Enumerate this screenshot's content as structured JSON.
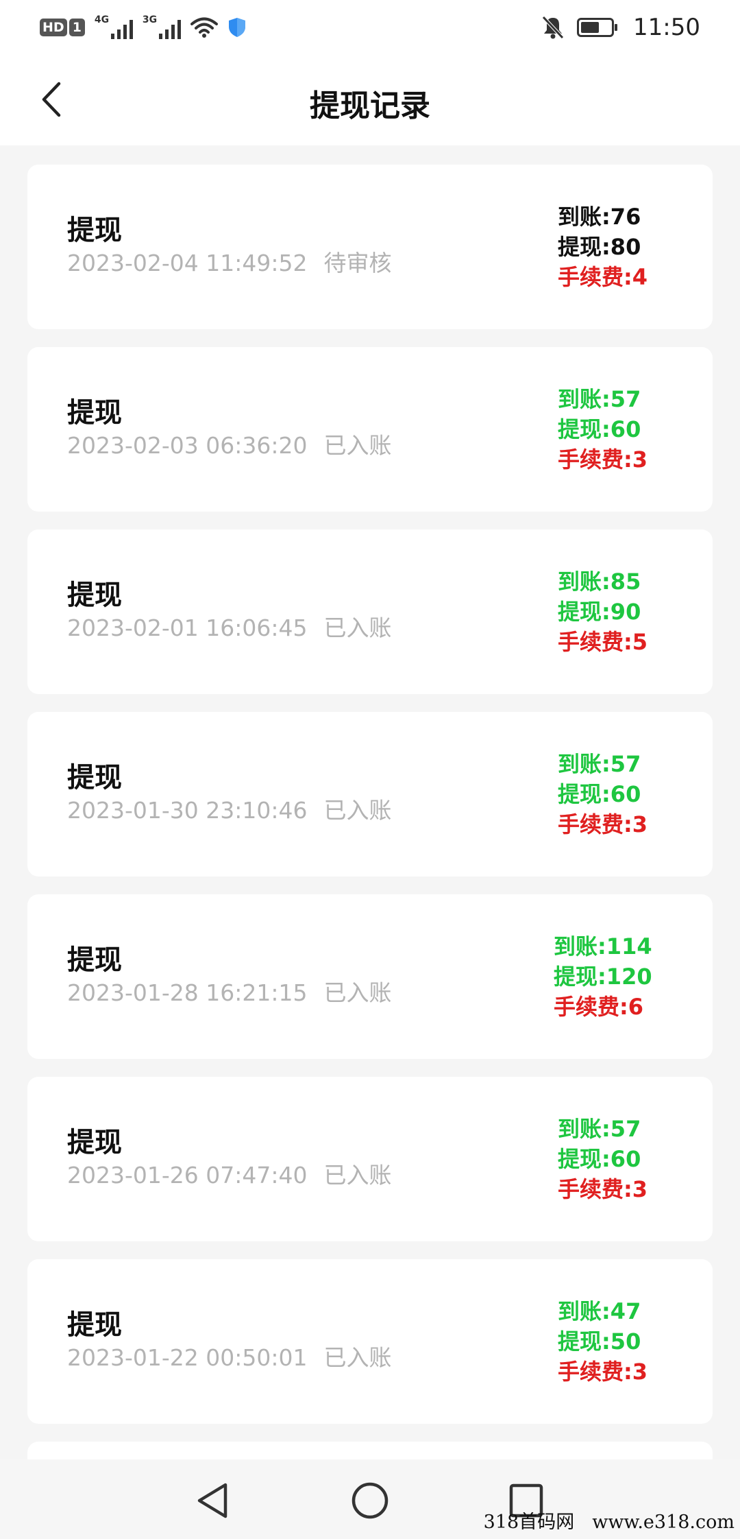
{
  "status_bar": {
    "hd_label": "HD",
    "sim_label": "1",
    "network_1": "4G",
    "network_2": "3G",
    "time": "11:50"
  },
  "header": {
    "title": "提现记录"
  },
  "colors": {
    "pending": "#111111",
    "completed": "#1ec640",
    "fee": "#e02020",
    "meta_gray": "#b3b3b3"
  },
  "records": [
    {
      "type": "提现",
      "datetime": "2023-02-04 11:49:52",
      "status": "待审核",
      "received": "到账:76",
      "withdrawn": "提现:80",
      "fee": "手续费:4",
      "state": "pending"
    },
    {
      "type": "提现",
      "datetime": "2023-02-03 06:36:20",
      "status": "已入账",
      "received": "到账:57",
      "withdrawn": "提现:60",
      "fee": "手续费:3",
      "state": "completed"
    },
    {
      "type": "提现",
      "datetime": "2023-02-01 16:06:45",
      "status": "已入账",
      "received": "到账:85",
      "withdrawn": "提现:90",
      "fee": "手续费:5",
      "state": "completed"
    },
    {
      "type": "提现",
      "datetime": "2023-01-30 23:10:46",
      "status": "已入账",
      "received": "到账:57",
      "withdrawn": "提现:60",
      "fee": "手续费:3",
      "state": "completed"
    },
    {
      "type": "提现",
      "datetime": "2023-01-28 16:21:15",
      "status": "已入账",
      "received": "到账:114",
      "withdrawn": "提现:120",
      "fee": "手续费:6",
      "state": "completed"
    },
    {
      "type": "提现",
      "datetime": "2023-01-26 07:47:40",
      "status": "已入账",
      "received": "到账:57",
      "withdrawn": "提现:60",
      "fee": "手续费:3",
      "state": "completed"
    },
    {
      "type": "提现",
      "datetime": "2023-01-22 00:50:01",
      "status": "已入账",
      "received": "到账:47",
      "withdrawn": "提现:50",
      "fee": "手续费:3",
      "state": "completed"
    }
  ],
  "watermark": {
    "left": "318首码网",
    "right": "www.e318.com"
  }
}
